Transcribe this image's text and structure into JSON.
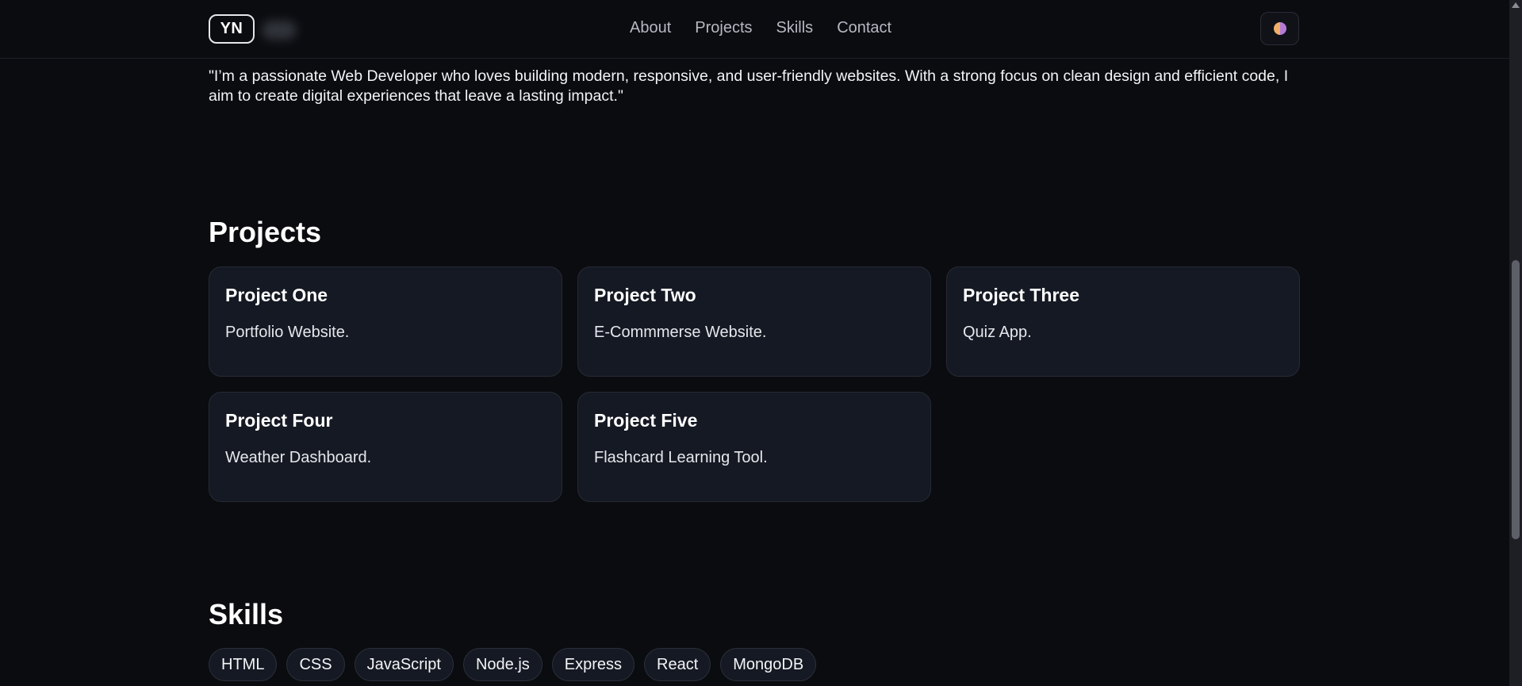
{
  "header": {
    "logo_text": "YN",
    "nav": [
      "About",
      "Projects",
      "Skills",
      "Contact"
    ],
    "theme_toggle_icon": "theme-toggle-icon"
  },
  "about": {
    "text": "\"I’m a passionate Web Developer who loves building modern, responsive, and user-friendly websites. With a strong focus on clean design and efficient code, I aim to create digital experiences that leave a lasting impact.\""
  },
  "projects": {
    "title": "Projects",
    "items": [
      {
        "title": "Project One",
        "desc": "Portfolio Website."
      },
      {
        "title": "Project Two",
        "desc": "E-Commmerse Website."
      },
      {
        "title": "Project Three",
        "desc": "Quiz App."
      },
      {
        "title": "Project Four",
        "desc": "Weather Dashboard."
      },
      {
        "title": "Project Five",
        "desc": "Flashcard Learning Tool."
      }
    ]
  },
  "skills": {
    "title": "Skills",
    "items": [
      "HTML",
      "CSS",
      "JavaScript",
      "Node.js",
      "Express",
      "React",
      "MongoDB"
    ]
  },
  "colors": {
    "background": "#0b0c10",
    "card": "#151923",
    "border": "#262a35",
    "text": "#f3f4f6",
    "nav_text": "#b5b9c2"
  }
}
